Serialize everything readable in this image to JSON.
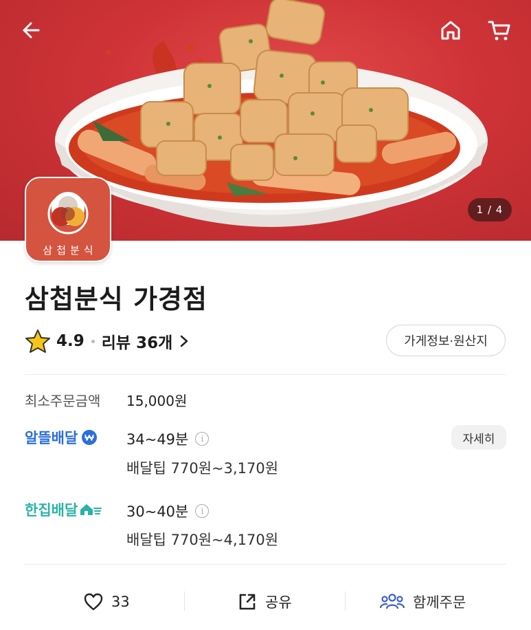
{
  "hero": {
    "counter": "1 / 4"
  },
  "logo": {
    "text": "삼첩분식"
  },
  "store": {
    "name": "삼첩분식 가경점",
    "rating": "4.9",
    "review_text": "리뷰 36개",
    "info_button": "가게정보·원산지"
  },
  "order_info": {
    "min_order_label": "최소주문금액",
    "min_order_value": "15,000원",
    "delivery_options": [
      {
        "name": "알뜰배달",
        "time": "34~49분",
        "tip": "배달팁 770원~3,170원"
      },
      {
        "name": "한집배달",
        "time": "30~40분",
        "tip": "배달팁 770원~4,170원"
      }
    ],
    "detail_button": "자세히"
  },
  "actions": {
    "like_count": "33",
    "share_label": "공유",
    "group_order_label": "함께주문"
  },
  "colors": {
    "hero_red": "#cf3337",
    "logo_bg": "#d4543f",
    "brand_blue": "#2a6fdb",
    "brand_teal": "#2bb2a6",
    "star": "#f5c518"
  },
  "icons": [
    "back-arrow-icon",
    "home-icon",
    "cart-icon",
    "star-icon",
    "chevron-right-icon",
    "info-icon",
    "heart-icon",
    "share-icon",
    "people-icon"
  ]
}
